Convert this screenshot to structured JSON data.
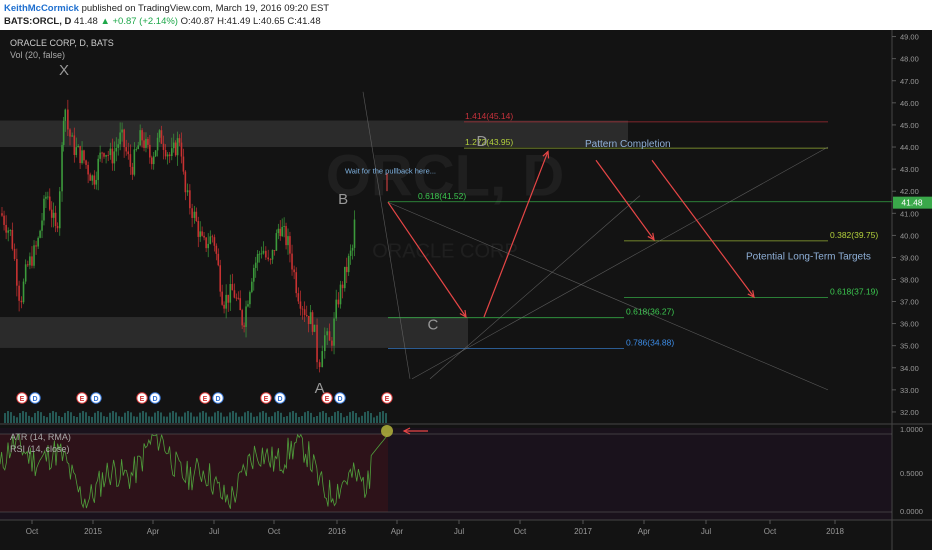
{
  "header": {
    "author": "KeithMcCormick",
    "published": "published on TradingView.com, March 19, 2016 09:20 EST",
    "symbol": "BATS:ORCL, D",
    "last": "41.48",
    "change": "+0.87 (+2.14%)",
    "open": "O:40.87",
    "high": "H:41.49",
    "low": "L:40.65",
    "close": "C:41.48"
  },
  "chart_data": {
    "type": "candlestick",
    "title": "ORACLE CORP, D, BATS",
    "volume_label": "Vol (20, false)",
    "watermark": "ORCL, D",
    "watermark_sub": "ORACLE CORP",
    "price_ylim": [
      31.5,
      49.3
    ],
    "price_ticks": [
      "49.00",
      "48.00",
      "47.00",
      "46.00",
      "45.00",
      "44.00",
      "43.00",
      "42.00",
      "41.00",
      "40.00",
      "39.00",
      "38.00",
      "37.00",
      "36.00",
      "35.00",
      "34.00",
      "33.00",
      "32.00"
    ],
    "last_price_label": "41.48",
    "x_ticks": [
      "Oct",
      "2015",
      "Apr",
      "Jul",
      "Oct",
      "2016",
      "Apr",
      "Jul",
      "Oct",
      "2017",
      "Apr",
      "Jul",
      "Oct",
      "2018"
    ],
    "price_path": [
      [
        "2014-09-15",
        41.0
      ],
      [
        "2014-10-01",
        40.0
      ],
      [
        "2014-10-15",
        37.0
      ],
      [
        "2014-10-25",
        38.5
      ],
      [
        "2014-11-10",
        39.5
      ],
      [
        "2014-11-25",
        42.0
      ],
      [
        "2014-12-10",
        40.0
      ],
      [
        "2014-12-17",
        43.0
      ],
      [
        "2014-12-22",
        46.5
      ],
      [
        "2014-12-26",
        45.0
      ],
      [
        "2015-01-05",
        44.0
      ],
      [
        "2015-01-20",
        43.5
      ],
      [
        "2015-02-05",
        42.5
      ],
      [
        "2015-02-20",
        44.0
      ],
      [
        "2015-03-05",
        43.5
      ],
      [
        "2015-03-20",
        44.5
      ],
      [
        "2015-04-05",
        43.0
      ],
      [
        "2015-04-20",
        44.5
      ],
      [
        "2015-05-05",
        43.5
      ],
      [
        "2015-05-20",
        44.5
      ],
      [
        "2015-06-05",
        43.5
      ],
      [
        "2015-06-20",
        44.5
      ],
      [
        "2015-06-26",
        42.0
      ],
      [
        "2015-07-10",
        41.0
      ],
      [
        "2015-07-25",
        39.5
      ],
      [
        "2015-08-10",
        40.0
      ],
      [
        "2015-08-25",
        37.0
      ],
      [
        "2015-09-10",
        37.5
      ],
      [
        "2015-09-25",
        36.0
      ],
      [
        "2015-10-10",
        38.5
      ],
      [
        "2015-10-25",
        39.5
      ],
      [
        "2015-11-05",
        38.5
      ],
      [
        "2015-11-20",
        40.5
      ],
      [
        "2015-12-05",
        39.5
      ],
      [
        "2015-12-18",
        37.5
      ],
      [
        "2015-12-31",
        36.5
      ],
      [
        "2016-01-12",
        36.0
      ],
      [
        "2016-01-20",
        34.0
      ],
      [
        "2016-01-28",
        35.5
      ],
      [
        "2016-02-08",
        35.0
      ],
      [
        "2016-02-18",
        37.0
      ],
      [
        "2016-02-28",
        38.0
      ],
      [
        "2016-03-08",
        39.0
      ],
      [
        "2016-03-14",
        39.5
      ],
      [
        "2016-03-18",
        41.48
      ]
    ],
    "rsi_label": "RSI (14, close)",
    "atr_label": "ATR (14, RMA)",
    "indicator_ticks": [
      "1.0000",
      "0.5000",
      "0.0000"
    ],
    "pattern_points": [
      {
        "label": "X",
        "date": "2014-12-20",
        "price": 47.0
      },
      {
        "label": "A",
        "date": "2016-01-20",
        "price": 33.5
      },
      {
        "label": "B",
        "date": "2016-03-18",
        "price": 41.52
      },
      {
        "label": "C",
        "date": "2016-07-01",
        "price": 36.27
      },
      {
        "label": "D",
        "date": "2016-09-15",
        "price": 43.95
      }
    ],
    "fib_levels": [
      {
        "label": "1.414(45.14)",
        "price": 45.14,
        "color": "#c8323c"
      },
      {
        "label": "1.272(43.95)",
        "price": 43.95,
        "color": "#b4d23c"
      },
      {
        "label": "0.618(41.52)",
        "price": 41.52,
        "color": "#3cc850"
      },
      {
        "label": "0.382(39.75)",
        "price": 39.75,
        "color": "#b4d23c"
      },
      {
        "label": "0.618(37.19)",
        "price": 37.19,
        "color": "#3cc850"
      },
      {
        "label": "0.618(36.27)",
        "price": 36.27,
        "color": "#3cc850"
      },
      {
        "label": "0.786(34.88)",
        "price": 34.88,
        "color": "#3c8ce6"
      }
    ],
    "annotations": {
      "pullback": "Wait for the pullback here...",
      "completion": "Pattern Completion",
      "targets": "Potential Long-Term Targets"
    },
    "earnings_markers": [
      "E",
      "D",
      "E",
      "D",
      "E",
      "D",
      "E",
      "D",
      "E",
      "D",
      "E",
      "D",
      "E"
    ],
    "colors": {
      "up": "#3c9b3c",
      "down": "#c83232",
      "accent": "#e64646",
      "rsi": "#50a03c"
    }
  }
}
